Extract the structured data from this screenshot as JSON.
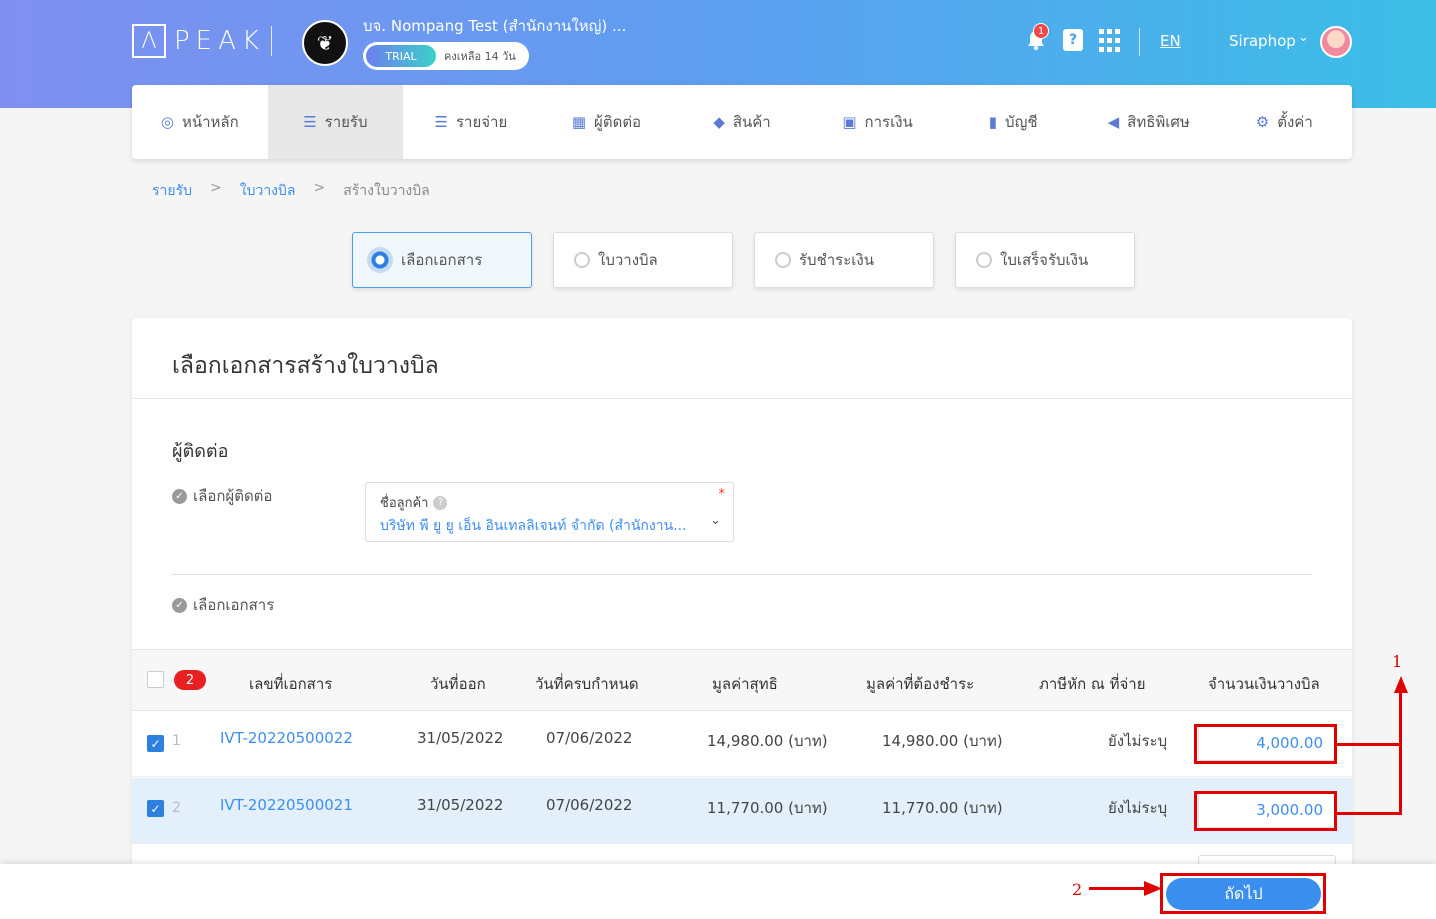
{
  "topbar": {
    "logo_mark": "Λ",
    "logo_text": "PEAK",
    "company_name": "บจ. Nompang Test (สำนักงานใหญ่) ...",
    "trial_tag": "TRIAL",
    "trial_remaining": "คงเหลือ 14 วัน",
    "notification_count": "1",
    "help_glyph": "?",
    "language": "EN",
    "user_name": "Siraphop"
  },
  "nav": {
    "items": [
      {
        "label": "หน้าหลัก",
        "icon": "dashboard-icon",
        "glyph": "◎"
      },
      {
        "label": "รายรับ",
        "icon": "income-icon",
        "glyph": "☰"
      },
      {
        "label": "รายจ่าย",
        "icon": "expense-icon",
        "glyph": "☰"
      },
      {
        "label": "ผู้ติดต่อ",
        "icon": "contacts-icon",
        "glyph": "▦"
      },
      {
        "label": "สินค้า",
        "icon": "product-box-icon",
        "glyph": "◆"
      },
      {
        "label": "การเงิน",
        "icon": "money-icon",
        "glyph": "▣"
      },
      {
        "label": "บัญชี",
        "icon": "ledger-book-icon",
        "glyph": "▮"
      },
      {
        "label": "สิทธิพิเศษ",
        "icon": "megaphone-icon",
        "glyph": "◀"
      },
      {
        "label": "ตั้งค่า",
        "icon": "gear-icon",
        "glyph": "⚙"
      }
    ],
    "active_index": 1
  },
  "breadcrumb": {
    "level1": "รายรับ",
    "level2": "ใบวางบิล",
    "current": "สร้างใบวางบิล",
    "separator": ">"
  },
  "steps": [
    {
      "label": "เลือกเอกสาร",
      "active": true
    },
    {
      "label": "ใบวางบิล",
      "active": false
    },
    {
      "label": "รับชำระเงิน",
      "active": false
    },
    {
      "label": "ใบเสร็จรับเงิน",
      "active": false
    }
  ],
  "card": {
    "title": "เลือกเอกสารสร้างใบวางบิล",
    "contact_section_title": "ผู้ติดต่อ",
    "select_contact_label": "เลือกผู้ติดต่อ",
    "customer_field_label": "ชื่อลูกค้า",
    "customer_value": "บริษัท พี ยู ยู เอ็น อินเทลลิเจนท์ จำกัด (สำนักงาน...",
    "required_mark": "*",
    "select_documents_label": "เลือกเอกสาร"
  },
  "table": {
    "selected_count": "2",
    "headers": {
      "doc_no": "เลขที่เอกสาร",
      "issue_date": "วันที่ออก",
      "due_date": "วันที่ครบกำหนด",
      "net_value": "มูลค่าสุทธิ",
      "amount_due": "มูลค่าที่ต้องชำระ",
      "withholding": "ภาษีหัก ณ ที่จ่าย",
      "billing_amount": "จำนวนเงินวางบิล"
    },
    "rows": [
      {
        "index": "1",
        "doc_no": "IVT-20220500022",
        "issue_date": "31/05/2022",
        "due_date": "07/06/2022",
        "net_value": "14,980.00 (บาท)",
        "amount_due": "14,980.00 (บาท)",
        "withholding": "ยังไม่ระบุ",
        "billing_amount": "4,000.00",
        "checked": true
      },
      {
        "index": "2",
        "doc_no": "IVT-20220500021",
        "issue_date": "31/05/2022",
        "due_date": "07/06/2022",
        "net_value": "11,770.00 (บาท)",
        "amount_due": "11,770.00 (บาท)",
        "withholding": "ยังไม่ระบุ",
        "billing_amount": "3,000.00",
        "checked": true
      }
    ]
  },
  "footer": {
    "next_label": "ถัดไป"
  },
  "annotations": {
    "label_1": "1",
    "label_2": "2",
    "color": "#e00000"
  }
}
